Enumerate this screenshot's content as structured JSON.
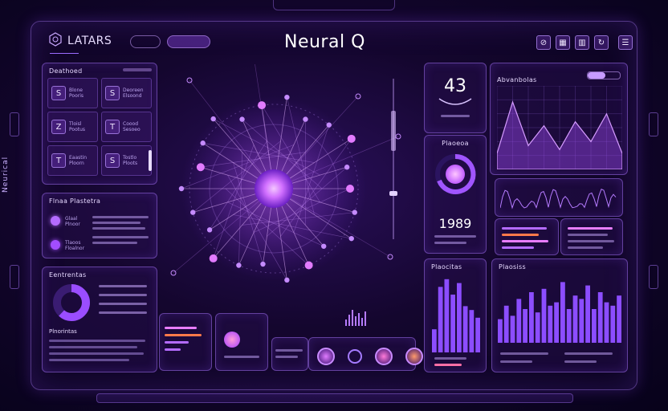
{
  "brand": {
    "logo_text": "LATARS"
  },
  "header": {
    "title": "Neural Q",
    "pills": [
      "",
      ""
    ]
  },
  "side_label": "Neurical",
  "left_top": {
    "title": "Deathoed",
    "cells": [
      {
        "glyph": "S",
        "lines": [
          "Blone",
          "Pooris"
        ]
      },
      {
        "glyph": "S",
        "lines": [
          "Deoreen",
          "Elsoond"
        ]
      },
      {
        "glyph": "Z",
        "lines": [
          "Tloisl",
          "Pootus"
        ]
      },
      {
        "glyph": "T",
        "lines": [
          "Coood",
          "Sesoeo"
        ]
      },
      {
        "glyph": "T",
        "lines": [
          "Eaastin",
          "Ploorn"
        ]
      },
      {
        "glyph": "S",
        "lines": [
          "Tostlo",
          "Ploots"
        ]
      }
    ]
  },
  "left_mid": {
    "title": "Flnaa Plastetra",
    "rows": [
      {
        "label": "Glaal",
        "sub": "Plnoor"
      },
      {
        "label": "Tlaoos",
        "sub": "Floalnor"
      }
    ]
  },
  "left_bottom": {
    "title": "Eentrentas",
    "subtitle": "Plnorintas",
    "pie": [
      0.62,
      0.38
    ]
  },
  "center_value_big": "43",
  "center_value_mid": "1989",
  "right_top": {
    "title": "Abvanbolas"
  },
  "panels": {
    "gauge_title": "Plaoeoa",
    "bars_left_title": "Plaocitas",
    "bars_right_title": "Plaosiss"
  },
  "colors": {
    "accent": "#b46bff",
    "bright": "#e3a2ff",
    "warm": "#ff7a4a"
  },
  "charts": {
    "area_peaks": [
      0.2,
      0.85,
      0.3,
      0.55,
      0.25,
      0.6,
      0.35,
      0.7,
      0.2
    ],
    "bars_left": [
      0.3,
      0.85,
      0.95,
      0.75,
      0.9,
      0.6,
      0.55,
      0.45
    ],
    "bars_right": [
      0.35,
      0.55,
      0.4,
      0.65,
      0.5,
      0.75,
      0.45,
      0.8,
      0.55,
      0.6,
      0.9,
      0.5,
      0.7,
      0.65,
      0.85,
      0.5,
      0.75,
      0.6,
      0.55,
      0.7
    ]
  }
}
